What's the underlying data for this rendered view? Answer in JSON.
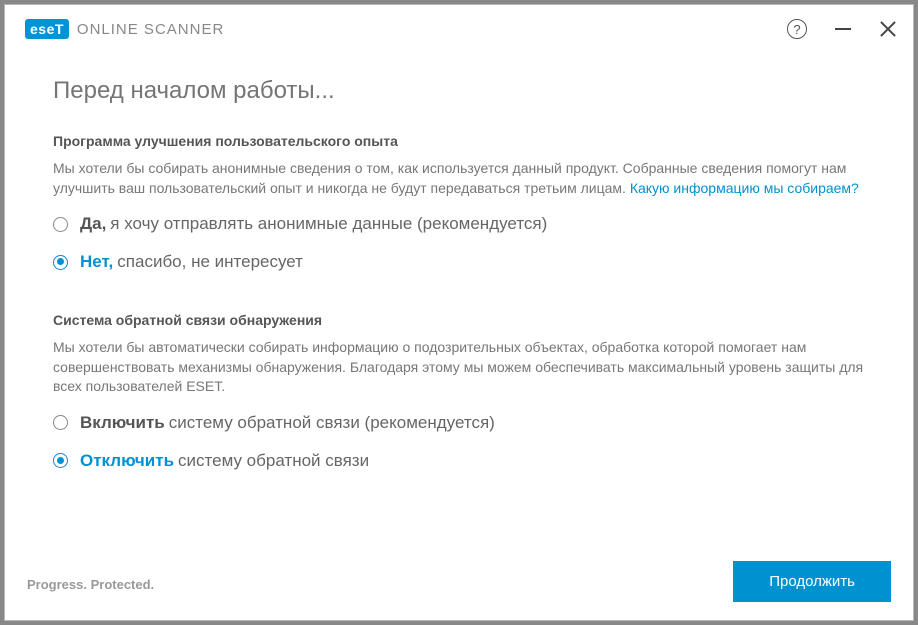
{
  "brand": {
    "logo_badge": "eseT",
    "logo_text": "ONLINE SCANNER",
    "tagline": "Progress. Protected."
  },
  "page_title": "Перед началом работы...",
  "section1": {
    "title": "Программа улучшения пользовательского опыта",
    "text": "Мы хотели бы собирать анонимные сведения о том, как используется данный продукт. Собранные сведения помогут нам улучшить ваш пользовательский опыт и никогда не будут передаваться третьим лицам. ",
    "link": "Какую информацию мы собираем?",
    "option1_bold": "Да,",
    "option1_rest": "я хочу отправлять анонимные данные (рекомендуется)",
    "option2_bold": "Нет,",
    "option2_rest": "спасибо, не интересует"
  },
  "section2": {
    "title": "Система обратной связи обнаружения",
    "text": "Мы хотели бы автоматически собирать информацию о подозрительных объектах, обработка которой помогает нам совершенствовать механизмы обнаружения. Благодаря этому мы можем обеспечивать максимальный уровень защиты для всех пользователей ESET.",
    "option1_bold": "Включить",
    "option1_rest": "систему обратной связи (рекомендуется)",
    "option2_bold": "Отключить",
    "option2_rest": "систему обратной связи"
  },
  "buttons": {
    "continue": "Продолжить"
  }
}
